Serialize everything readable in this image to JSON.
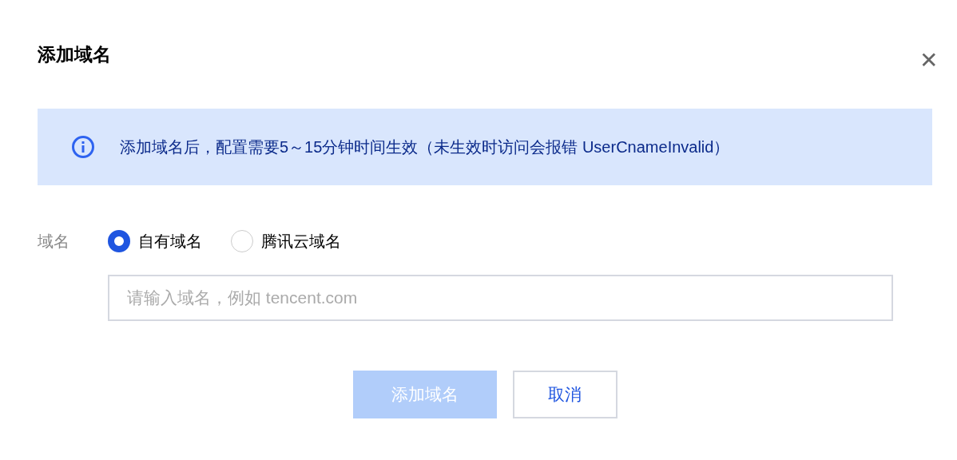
{
  "dialog": {
    "title": "添加域名",
    "close_label": "✕"
  },
  "notice": {
    "text": "添加域名后，配置需要5～15分钟时间生效（未生效时访问会报错 UserCnameInvalid）"
  },
  "domain_type": {
    "label": "域名",
    "options": [
      {
        "label": "自有域名",
        "selected": true
      },
      {
        "label": "腾讯云域名",
        "selected": false
      }
    ]
  },
  "domain_input": {
    "placeholder": "请输入域名，例如 tencent.com"
  },
  "buttons": [
    {
      "label": "添加域名",
      "kind": "primary",
      "disabled": true
    },
    {
      "label": "取消",
      "kind": "secondary",
      "disabled": false
    }
  ]
}
